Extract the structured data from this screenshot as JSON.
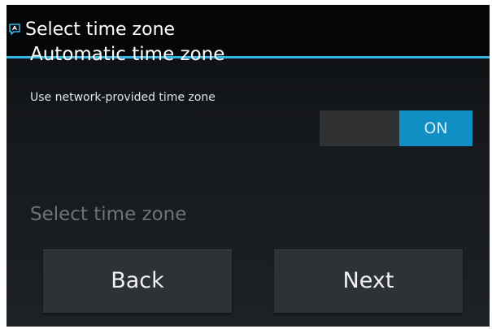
{
  "window": {
    "title": "Select time zone",
    "icon": "alert-chat-icon",
    "accent_color": "#33b5e5"
  },
  "automatic_time_zone": {
    "title": "Automatic time zone",
    "summary": "Use network-provided time zone",
    "toggle_label": "ON",
    "toggle_color": "#0f8fc3"
  },
  "select_time_zone": {
    "label": "Select time zone"
  },
  "buttons": {
    "back": "Back",
    "next": "Next"
  }
}
